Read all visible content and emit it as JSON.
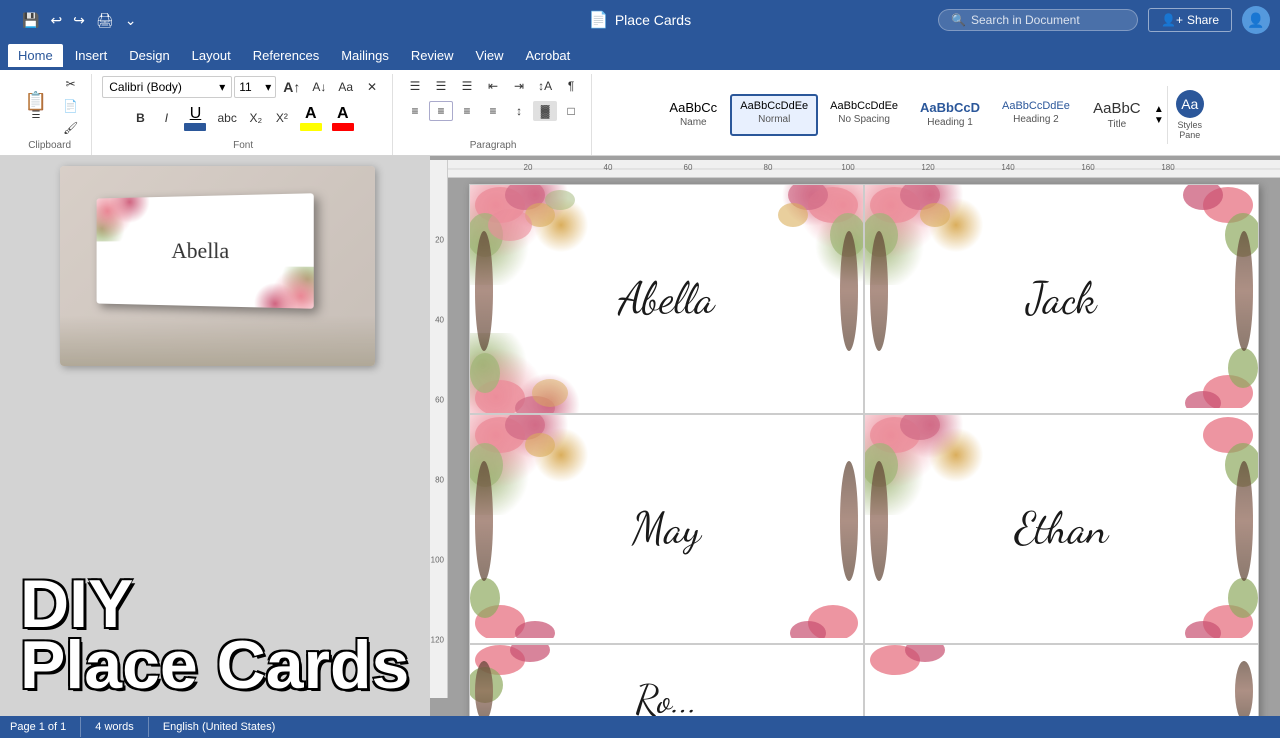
{
  "titlebar": {
    "title": "Place Cards",
    "doc_icon": "📄",
    "search_placeholder": "Search in Document",
    "share_label": "Share",
    "user_initial": "👤"
  },
  "quick_access": {
    "save_tooltip": "Save",
    "undo_tooltip": "Undo",
    "redo_tooltip": "Redo",
    "print_tooltip": "Print",
    "more_tooltip": "More"
  },
  "menu": {
    "items": [
      "Home",
      "Insert",
      "Design",
      "Layout",
      "References",
      "Mailings",
      "Review",
      "View",
      "Acrobat"
    ]
  },
  "ribbon": {
    "font": {
      "family": "Calibri (Body)",
      "size": "11",
      "bold": "B",
      "italic": "I",
      "underline": "U",
      "strikethrough": "abc",
      "subscript": "X₂",
      "superscript": "X²",
      "increase_font": "A",
      "decrease_font": "A",
      "change_case": "Aa",
      "clear_format": "✕",
      "highlight": "A",
      "font_color": "A"
    },
    "paragraph": {
      "bullets": "☰",
      "numbering": "☰",
      "multilevel": "☰",
      "decrease_indent": "←",
      "increase_indent": "→",
      "sort": "↕",
      "show_hide": "¶",
      "align_left": "≡",
      "align_center": "≡",
      "align_right": "≡",
      "justify": "≡",
      "line_spacing": "↕",
      "shading": "▓",
      "border": "□"
    },
    "styles": {
      "name_style": "AaBbCc",
      "normal_style": "AaBbCcDdEe",
      "no_spacing_style": "AaBbCcDdEe",
      "heading1_style": "AaBbCcD",
      "heading2_style": "AaBbCcDdEe",
      "title_style": "AaBbC",
      "name_label": "Name",
      "normal_label": "Normal",
      "no_spacing_label": "No Spacing",
      "heading1_label": "Heading 1",
      "heading2_label": "Heading 2",
      "title_label": "Title",
      "styles_pane_label": "Styles\nPane"
    }
  },
  "cards": {
    "card1_name": "Abella",
    "card2_name": "Jack",
    "card3_name": "May",
    "card4_name": "Ethan",
    "card5_name": "Ro..."
  },
  "overlay": {
    "line1": "DIY",
    "line2": "Place Cards"
  },
  "preview": {
    "name": "Abella"
  },
  "ruler": {
    "h_marks": [
      "20",
      "40",
      "60",
      "80",
      "100",
      "120",
      "140",
      "160",
      "180"
    ],
    "v_marks": [
      "20",
      "40",
      "60",
      "80",
      "100",
      "120"
    ]
  }
}
